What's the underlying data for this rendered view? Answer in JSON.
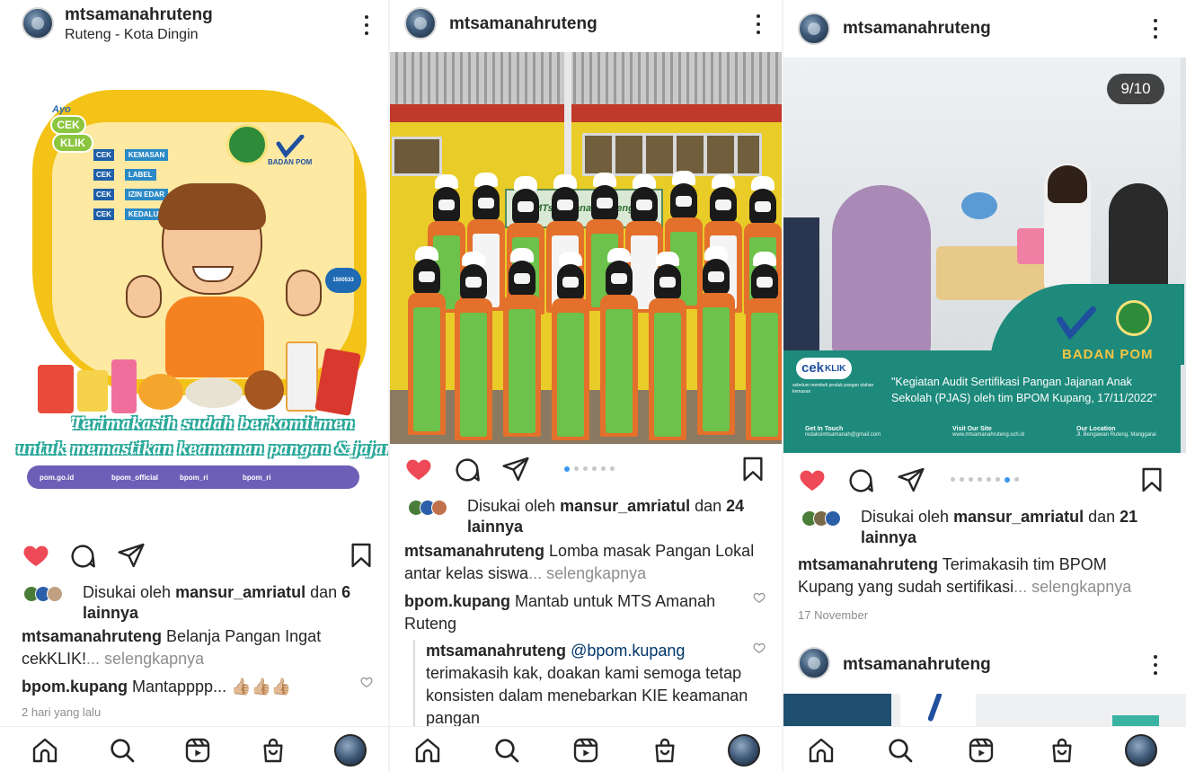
{
  "colors": {
    "like_red": "#ed4956",
    "link_gray": "#8e8e8e",
    "dot_blue": "#3897f0",
    "text": "#262626"
  },
  "panels": [
    {
      "username": "mtsamanahruteng",
      "location": "Ruteng - Kota Dingin",
      "poster": {
        "ayo": "Ayo",
        "cek": "CEK",
        "klik": "KLIK",
        "checklist": [
          "KEMASAN",
          "LABEL",
          "IZIN EDAR",
          "KEDALUWARSA"
        ],
        "brand": "BADAN POM",
        "hotline": "1500533",
        "line1": "Terimakasih sudah berkomitmen",
        "line2": "untuk memastikan keamanan pangan & jajanan",
        "socials": [
          "pom.go.id",
          "bpom_official",
          "bpom_ri",
          "bpom_ri"
        ]
      },
      "liked_by_prefix": "Disukai oleh ",
      "liked_by_user": "mansur_amriatul",
      "liked_by_and": " dan ",
      "liked_by_count": "6",
      "liked_by_suffix": "lainnya",
      "caption_user": "mtsamanahruteng",
      "caption_text": " Belanja Pangan Ingat cekKLIK!",
      "more_text": "... selengkapnya",
      "comment_user": "bpom.kupang",
      "comment_text": " Mantapppp... 👍🏼👍🏼👍🏼",
      "time": "2 hari yang lalu"
    },
    {
      "username": "mtsamanahruteng",
      "banner": "MTs. Amanah Ruteng",
      "liked_by_prefix": "Disukai oleh ",
      "liked_by_user": "mansur_amriatul",
      "liked_by_and": " dan ",
      "liked_by_count": "24",
      "liked_by_suffix": "lainnya",
      "caption_user": "mtsamanahruteng",
      "caption_text": " Lomba masak Pangan Lokal antar kelas siswa",
      "more_text": "... selengkapnya",
      "comment_user": "bpom.kupang",
      "comment_text": " Mantab untuk MTS Amanah Ruteng",
      "reply_user": "mtsamanahruteng",
      "reply_mention": "@bpom.kupang",
      "reply_text": "terimakasih kak, doakan kami semoga tetap konsisten dalam menebarkan KIE keamanan pangan"
    },
    {
      "username": "mtsamanahruteng",
      "counter": "9/10",
      "cekklik_cek": "cek",
      "cekklik_klik": "KLIK",
      "cekklik_sub": "sebelum membeli produk pangan olahan kemasan",
      "brand": "BADAN POM",
      "overlay_caption": "\"Kegiatan Audit Sertifikasi Pangan Jajanan Anak Sekolah (PJAS) oleh tim BPOM Kupang, 17/11/2022\"",
      "footer": [
        {
          "title": "Get In Touch",
          "value": "redaksimtsamanah@gmail.com"
        },
        {
          "title": "Visit Our Site",
          "value": "www.mtsamanahruteng.sch.id"
        },
        {
          "title": "Our Location",
          "value": "Jl. Bengawan Ruteng, Manggarai"
        }
      ],
      "liked_by_prefix": "Disukai oleh ",
      "liked_by_user": "mansur_amriatul",
      "liked_by_and": " dan ",
      "liked_by_count": "21",
      "liked_by_suffix": "lainnya",
      "caption_user": "mtsamanahruteng",
      "caption_text": " Terimakasih tim BPOM Kupang yang sudah sertifikasi",
      "more_text": "... selengkapnya",
      "time": "17 November",
      "next_username": "mtsamanahruteng"
    }
  ]
}
